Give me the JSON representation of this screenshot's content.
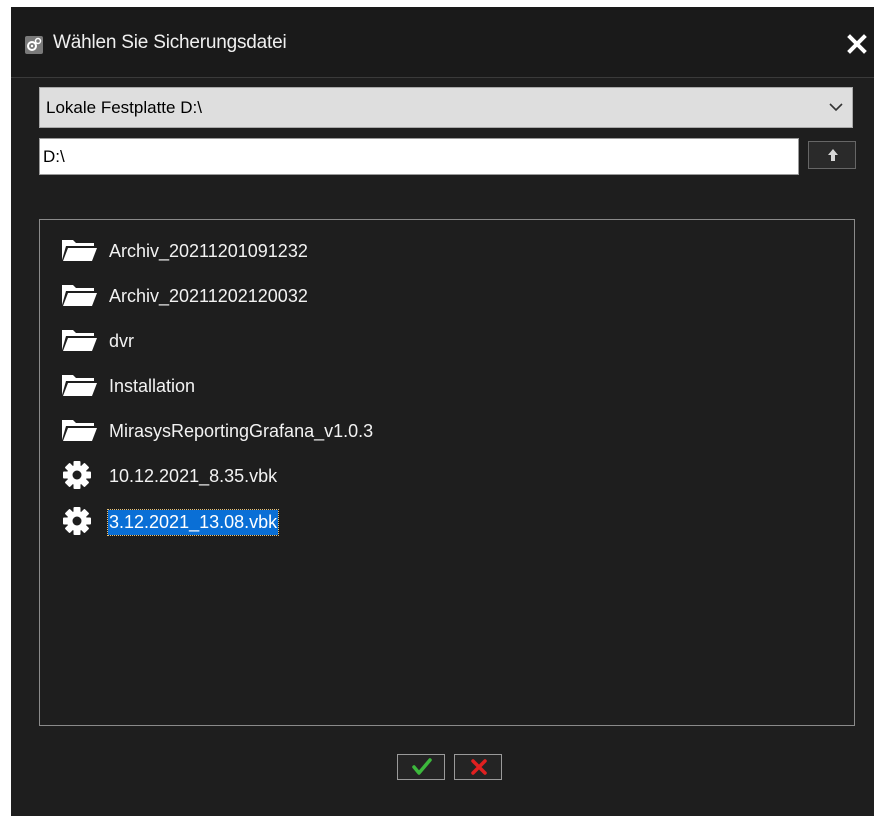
{
  "window": {
    "title": "Wählen Sie Sicherungsdatei",
    "title_icon": "gears-icon",
    "close_icon": "close-icon"
  },
  "drive_select": {
    "selected": "Lokale Festplatte D:\\",
    "icon": "chevron-down-icon"
  },
  "path": {
    "value": "D:\\",
    "up_icon": "arrow-up-icon"
  },
  "files": [
    {
      "name": "Archiv_20211201091232",
      "type": "folder",
      "icon": "folder-icon",
      "selected": false
    },
    {
      "name": "Archiv_20211202120032",
      "type": "folder",
      "icon": "folder-icon",
      "selected": false
    },
    {
      "name": "dvr",
      "type": "folder",
      "icon": "folder-icon",
      "selected": false
    },
    {
      "name": "Installation",
      "type": "folder",
      "icon": "folder-icon",
      "selected": false
    },
    {
      "name": "MirasysReportingGrafana_v1.0.3",
      "type": "folder",
      "icon": "folder-icon",
      "selected": false
    },
    {
      "name": "10.12.2021_8.35.vbk",
      "type": "file",
      "icon": "gear-icon",
      "selected": false
    },
    {
      "name": "3.12.2021_13.08.vbk",
      "type": "file",
      "icon": "gear-icon",
      "selected": true
    }
  ],
  "footer": {
    "ok_icon": "checkmark-icon",
    "cancel_icon": "x-icon"
  },
  "colors": {
    "background": "#1e1e1e",
    "selection": "#0a6fd6",
    "ok_green": "#3cb83c",
    "cancel_red": "#e02020"
  }
}
